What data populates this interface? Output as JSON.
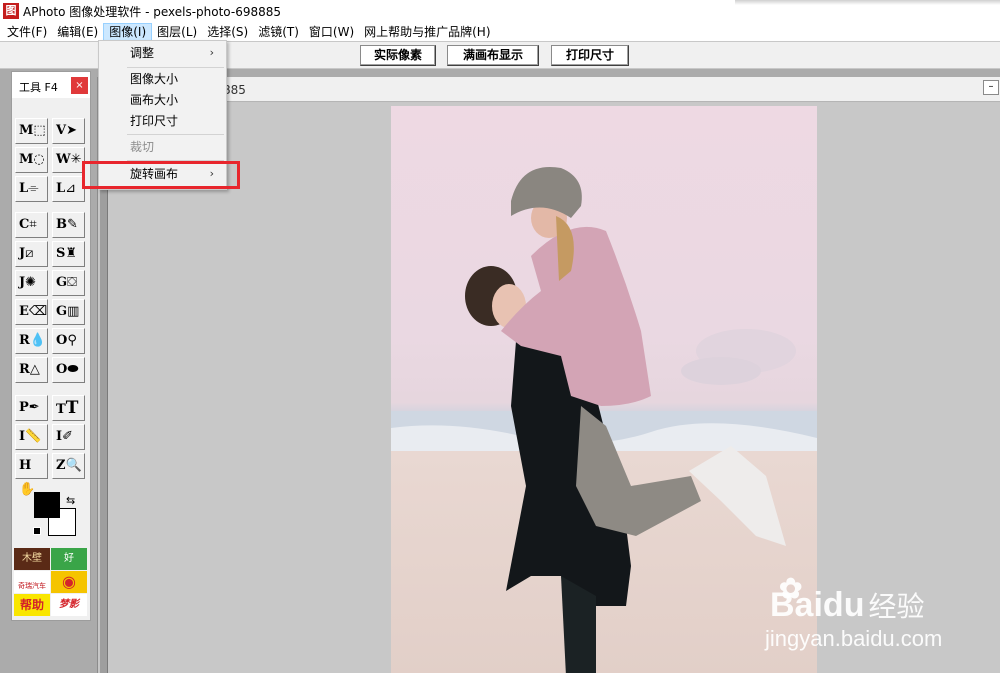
{
  "window": {
    "icon_text": "图",
    "title": "APhoto 图像处理软件 - pexels-photo-698885"
  },
  "menubar": {
    "items": [
      "文件(F)",
      "编辑(E)",
      "图像(I)",
      "图层(L)",
      "选择(S)",
      "滤镜(T)",
      "窗口(W)",
      "网上帮助与推广品牌(H)"
    ]
  },
  "toolbar": {
    "actual_pixels": "实际像素",
    "fit_canvas": "满画布显示",
    "print_size": "打印尺寸"
  },
  "image_menu": {
    "adjust": "调整",
    "image_size": "图像大小",
    "canvas_size": "画布大小",
    "print_size": "打印尺寸",
    "crop": "裁切",
    "rotate_canvas": "旋转画布"
  },
  "document": {
    "title": "885",
    "min_symbol": "–"
  },
  "tools": {
    "panel_title": "工具 F4",
    "close": "×",
    "letters": [
      "M",
      "V",
      "M",
      "W",
      "L",
      "L",
      "C",
      "B",
      "J",
      "S",
      "J",
      "G",
      "E",
      "G",
      "R",
      "O",
      "R",
      "O",
      "P",
      "T",
      "I",
      "I",
      "H",
      "Z"
    ],
    "swap_symbol": "⇆"
  },
  "ads": {
    "a1": "木壁",
    "a2": "好",
    "a3": "奇瑞汽车",
    "a4": "",
    "a5": "帮助",
    "a6": "梦影"
  },
  "watermark": {
    "brand": "Bai",
    "brand2": "du",
    "brand_cn": "经验",
    "url": "jingyan.baidu.com"
  }
}
